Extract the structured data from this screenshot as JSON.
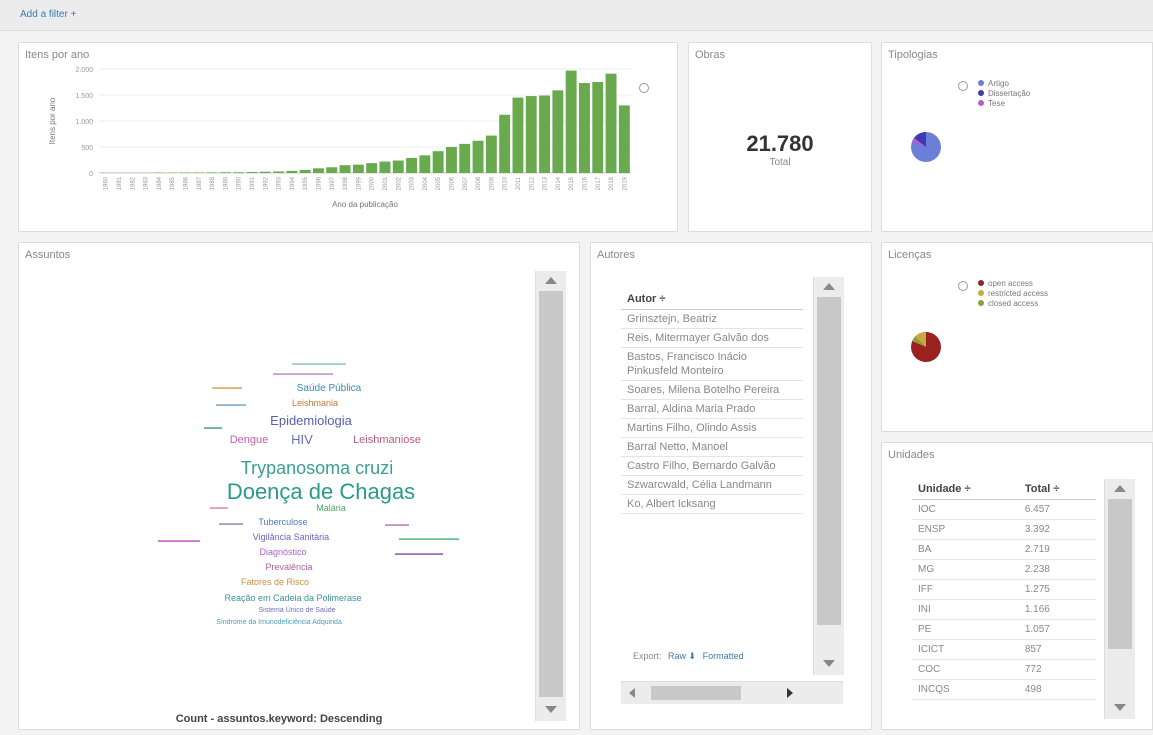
{
  "toolbar": {
    "add_filter": "Add a filter +"
  },
  "colors": {
    "bar": "#6aaa4e",
    "accent": "#3a7ab8",
    "pie_blue": "#6c7fd8",
    "pie_red": "#9b2020"
  },
  "panels": {
    "itens": {
      "title": "Itens por ano",
      "chart_data": {
        "type": "bar",
        "title": "Itens por ano",
        "xlabel": "Ano da publicação",
        "ylabel": "Itens por ano",
        "ylim": [
          0,
          2000
        ],
        "yticks": [
          "0",
          "500",
          "1.000",
          "1.500",
          "2.000"
        ],
        "categories": [
          "1980",
          "1981",
          "1982",
          "1983",
          "1984",
          "1985",
          "1986",
          "1987",
          "1988",
          "1989",
          "1990",
          "1991",
          "1992",
          "1993",
          "1994",
          "1995",
          "1996",
          "1997",
          "1998",
          "1999",
          "2000",
          "2001",
          "2002",
          "2003",
          "2004",
          "2005",
          "2006",
          "2007",
          "2008",
          "2009",
          "2010",
          "2011",
          "2012",
          "2013",
          "2014",
          "2015",
          "2016",
          "2017",
          "2018",
          "2019"
        ],
        "values": [
          5,
          5,
          5,
          5,
          8,
          8,
          10,
          10,
          12,
          15,
          15,
          20,
          25,
          30,
          40,
          60,
          90,
          110,
          150,
          160,
          190,
          220,
          240,
          290,
          340,
          420,
          500,
          560,
          620,
          720,
          1120,
          1450,
          1480,
          1490,
          1590,
          1970,
          1730,
          1750,
          1910,
          1300
        ]
      }
    },
    "obras": {
      "title": "Obras",
      "metric_value": "21.780",
      "metric_label": "Total"
    },
    "tipologias": {
      "title": "Tipologias",
      "legend": [
        {
          "label": "Artigo",
          "color": "#6c7fd8"
        },
        {
          "label": "Dissertação",
          "color": "#3b3bb5"
        },
        {
          "label": "Tese",
          "color": "#b55cd6"
        }
      ]
    },
    "assuntos": {
      "title": "Assuntos",
      "footer": "Count - assuntos.keyword: Descending",
      "words": [
        {
          "text": "Doença de Chagas",
          "color": "#2a9a8a"
        },
        {
          "text": "Trypanosoma cruzi",
          "color": "#3aa090"
        },
        {
          "text": "Epidemiologia",
          "color": "#5560b0"
        },
        {
          "text": "HIV",
          "color": "#6a6ac8"
        },
        {
          "text": "Dengue",
          "color": "#c060b0"
        },
        {
          "text": "Leishmaniose",
          "color": "#c05a7a"
        },
        {
          "text": "Saúde Pública",
          "color": "#3a8ab0"
        },
        {
          "text": "Leishmania",
          "color": "#c07a3a"
        },
        {
          "text": "Malária",
          "color": "#4aa868"
        },
        {
          "text": "Tuberculose",
          "color": "#4a78c0"
        },
        {
          "text": "Vigilância Sanitária",
          "color": "#7060c0"
        },
        {
          "text": "Diagnóstico",
          "color": "#b060c8"
        },
        {
          "text": "Prevalência",
          "color": "#b060a0"
        },
        {
          "text": "Fatores de Risco",
          "color": "#d09040"
        },
        {
          "text": "Reação em Cadeia da Polimerase",
          "color": "#3a90a0"
        },
        {
          "text": "Sistema Único de Saúde",
          "color": "#7070c0"
        },
        {
          "text": "Síndrome da Imunodeficiência Adquirida",
          "color": "#4aa0b0"
        }
      ]
    },
    "autores": {
      "title": "Autores",
      "column": "Autor ÷",
      "rows": [
        "Grinsztejn, Beatriz",
        "Reis, Mitermayer Galvão dos",
        "Bastos, Francisco Inácio Pinkusfeld Monteiro",
        "Soares, Milena Botelho Pereira",
        "Barral, Aldina Maria Prado",
        "Martins Filho, Olindo Assis",
        "Barral Netto, Manoel",
        "Castro Filho, Bernardo Galvão",
        "Szwarcwald, Célia Landmann",
        "Ko, Albert Icksang"
      ],
      "export_label": "Export:",
      "export_raw": "Raw ⬇",
      "export_formatted": "Formatted"
    },
    "licencas": {
      "title": "Licenças",
      "legend": [
        {
          "label": "open access",
          "color": "#9b2020"
        },
        {
          "label": "restricted access",
          "color": "#c8a840"
        },
        {
          "label": "closed access",
          "color": "#8aa040"
        }
      ]
    },
    "unidades": {
      "title": "Unidades",
      "headers": [
        "Unidade ÷",
        "Total ÷"
      ],
      "rows": [
        [
          "IOC",
          "6.457"
        ],
        [
          "ENSP",
          "3.392"
        ],
        [
          "BA",
          "2.719"
        ],
        [
          "MG",
          "2.238"
        ],
        [
          "IFF",
          "1.275"
        ],
        [
          "INI",
          "1.166"
        ],
        [
          "PE",
          "1.057"
        ],
        [
          "ICICT",
          "857"
        ],
        [
          "COC",
          "772"
        ],
        [
          "INCQS",
          "498"
        ]
      ]
    }
  }
}
